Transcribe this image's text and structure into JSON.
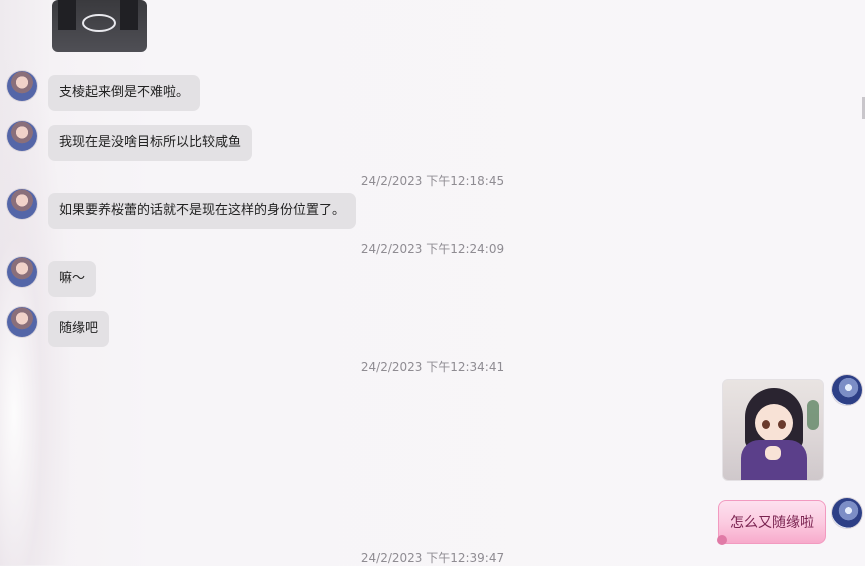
{
  "messages": [
    {
      "side": "left",
      "type": "sticker",
      "sticker": "black-cat-sticker"
    },
    {
      "side": "left",
      "type": "text",
      "text": "支棱起来倒是不难啦。"
    },
    {
      "side": "left",
      "type": "text",
      "text": "我现在是没啥目标所以比较咸鱼"
    },
    {
      "type": "timestamp",
      "text": "24/2/2023 下午12:18:45"
    },
    {
      "side": "left",
      "type": "text",
      "text": "如果要养桜蕾的话就不是现在这样的身份位置了。"
    },
    {
      "type": "timestamp",
      "text": "24/2/2023 下午12:24:09"
    },
    {
      "side": "left",
      "type": "text",
      "text": "嘛～"
    },
    {
      "side": "left",
      "type": "text",
      "text": "随缘吧"
    },
    {
      "type": "timestamp",
      "text": "24/2/2023 下午12:34:41"
    },
    {
      "side": "right",
      "type": "sticker",
      "sticker": "anime-girl-praying-sticker"
    },
    {
      "side": "right",
      "type": "text",
      "text": "怎么又随缘啦"
    },
    {
      "type": "timestamp",
      "text": "24/2/2023 下午12:39:47"
    }
  ],
  "colors": {
    "background": "#f8f6f9",
    "bubble_left": "#e3e1e4",
    "bubble_pink": "#fbc9df",
    "timestamp_text": "#8f8c92"
  }
}
